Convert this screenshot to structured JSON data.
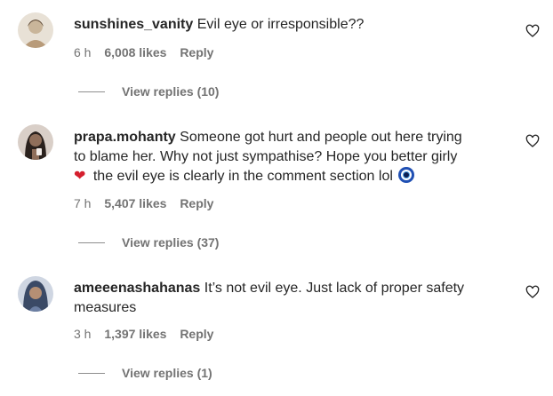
{
  "comments": [
    {
      "username": "sunshines_vanity",
      "text": "Evil eye or irresponsible??",
      "time": "6 h",
      "likes": "6,008 likes",
      "reply": "Reply",
      "view_replies": "View replies (10)",
      "avatar_color": "#c9b59a"
    },
    {
      "username": "prapa.mohanty",
      "text_line1": "Someone got hurt and people out here trying",
      "text_line2": "to blame her. Why not just sympathise? Hope you better girly",
      "heart_emoji": "❤",
      "text_line3": "the evil eye is clearly in the comment section lol",
      "evil_eye_emoji": "🧿",
      "time": "7 h",
      "likes": "5,407 likes",
      "reply": "Reply",
      "view_replies": "View replies (37)",
      "avatar_color": "#6b5547"
    },
    {
      "username": "ameeenashahanas",
      "text_line1": "It’s not evil eye. Just lack of proper safety",
      "text_line2": "measures",
      "time": "3 h",
      "likes": "1,397 likes",
      "reply": "Reply",
      "view_replies": "View replies (1)",
      "avatar_color": "#4a5a78"
    }
  ]
}
